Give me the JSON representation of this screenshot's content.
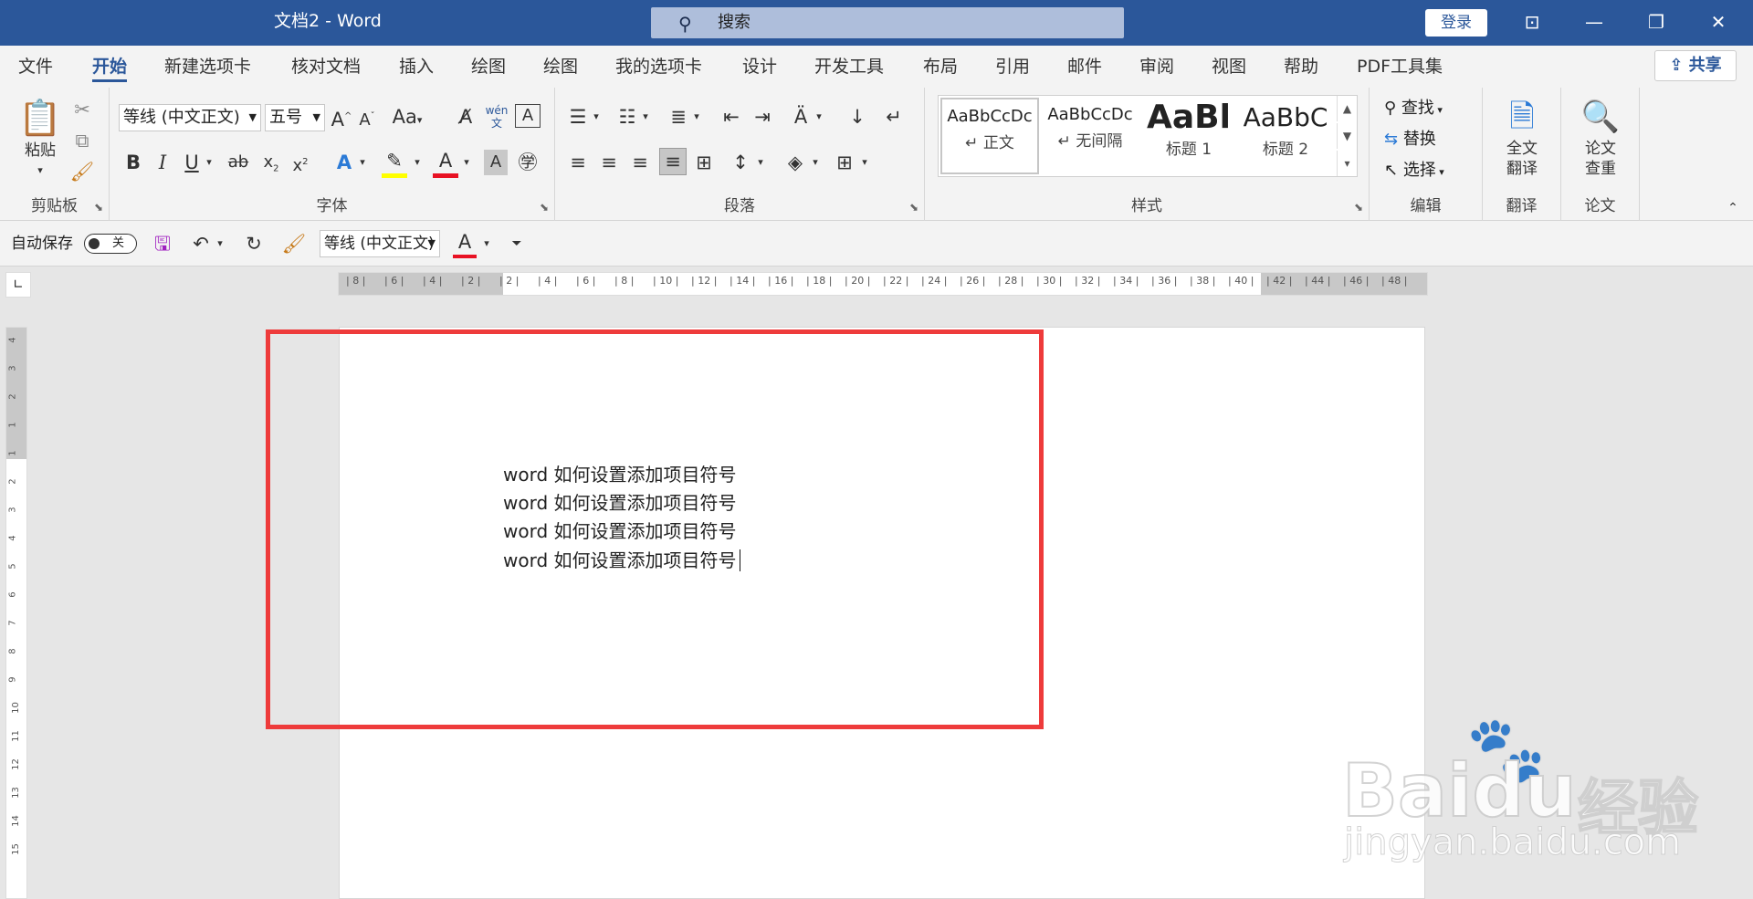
{
  "title_bar": {
    "doc_title": "文档2  -  Word",
    "search_placeholder": "搜索",
    "login": "登录"
  },
  "tabs": [
    "文件",
    "开始",
    "新建选项卡",
    "核对文档",
    "插入",
    "绘图",
    "绘图",
    "我的选项卡",
    "设计",
    "开发工具",
    "布局",
    "引用",
    "邮件",
    "审阅",
    "视图",
    "帮助",
    "PDF工具集"
  ],
  "active_tab": "开始",
  "share": "共享",
  "ribbon": {
    "clipboard": {
      "label": "剪贴板",
      "paste": "粘贴"
    },
    "font": {
      "label": "字体",
      "font_name": "等线 (中文正文)",
      "font_size": "五号",
      "aa": "Aa",
      "wen": "wén"
    },
    "paragraph": {
      "label": "段落"
    },
    "styles": {
      "label": "样式",
      "items": [
        {
          "sample": "AaBbCcDc",
          "name": "↵ 正文"
        },
        {
          "sample": "AaBbCcDc",
          "name": "↵ 无间隔"
        },
        {
          "sample": "AaBl",
          "name": "标题 1"
        },
        {
          "sample": "AaBbC",
          "name": "标题 2"
        }
      ]
    },
    "editing": {
      "label": "编辑",
      "find": "查找",
      "replace": "替换",
      "select": "选择"
    },
    "translate": {
      "label": "翻译",
      "full_text_1": "全文",
      "full_text_2": "翻译"
    },
    "thesis": {
      "label": "论文",
      "check_1": "论文",
      "check_2": "查重"
    }
  },
  "qat": {
    "autosave": "自动保存",
    "autosave_state": "关",
    "font_name": "等线 (中文正文)"
  },
  "ruler_ticks": [
    "8",
    "6",
    "4",
    "2",
    "2",
    "4",
    "6",
    "8",
    "10",
    "12",
    "14",
    "16",
    "18",
    "20",
    "22",
    "24",
    "26",
    "28",
    "30",
    "32",
    "34",
    "36",
    "38",
    "40",
    "42",
    "44",
    "46",
    "48"
  ],
  "vruler_ticks": [
    "4",
    "3",
    "2",
    "1",
    "1",
    "2",
    "3",
    "4",
    "5",
    "6",
    "7",
    "8",
    "9",
    "10",
    "11",
    "12",
    "13",
    "14",
    "15"
  ],
  "document": {
    "lines": [
      "word 如何设置添加项目符号",
      "word 如何设置添加项目符号",
      "word 如何设置添加项目符号",
      "word 如何设置添加项目符号"
    ]
  },
  "watermark": {
    "brand": "Baidu",
    "brand_cn": "经验",
    "url": "jingyan.baidu.com"
  },
  "colors": {
    "accent": "#2b579a",
    "highlight_box": "#ee3b3b",
    "font_color_bar": "#e81123",
    "highlight_bar": "#ffff00"
  }
}
